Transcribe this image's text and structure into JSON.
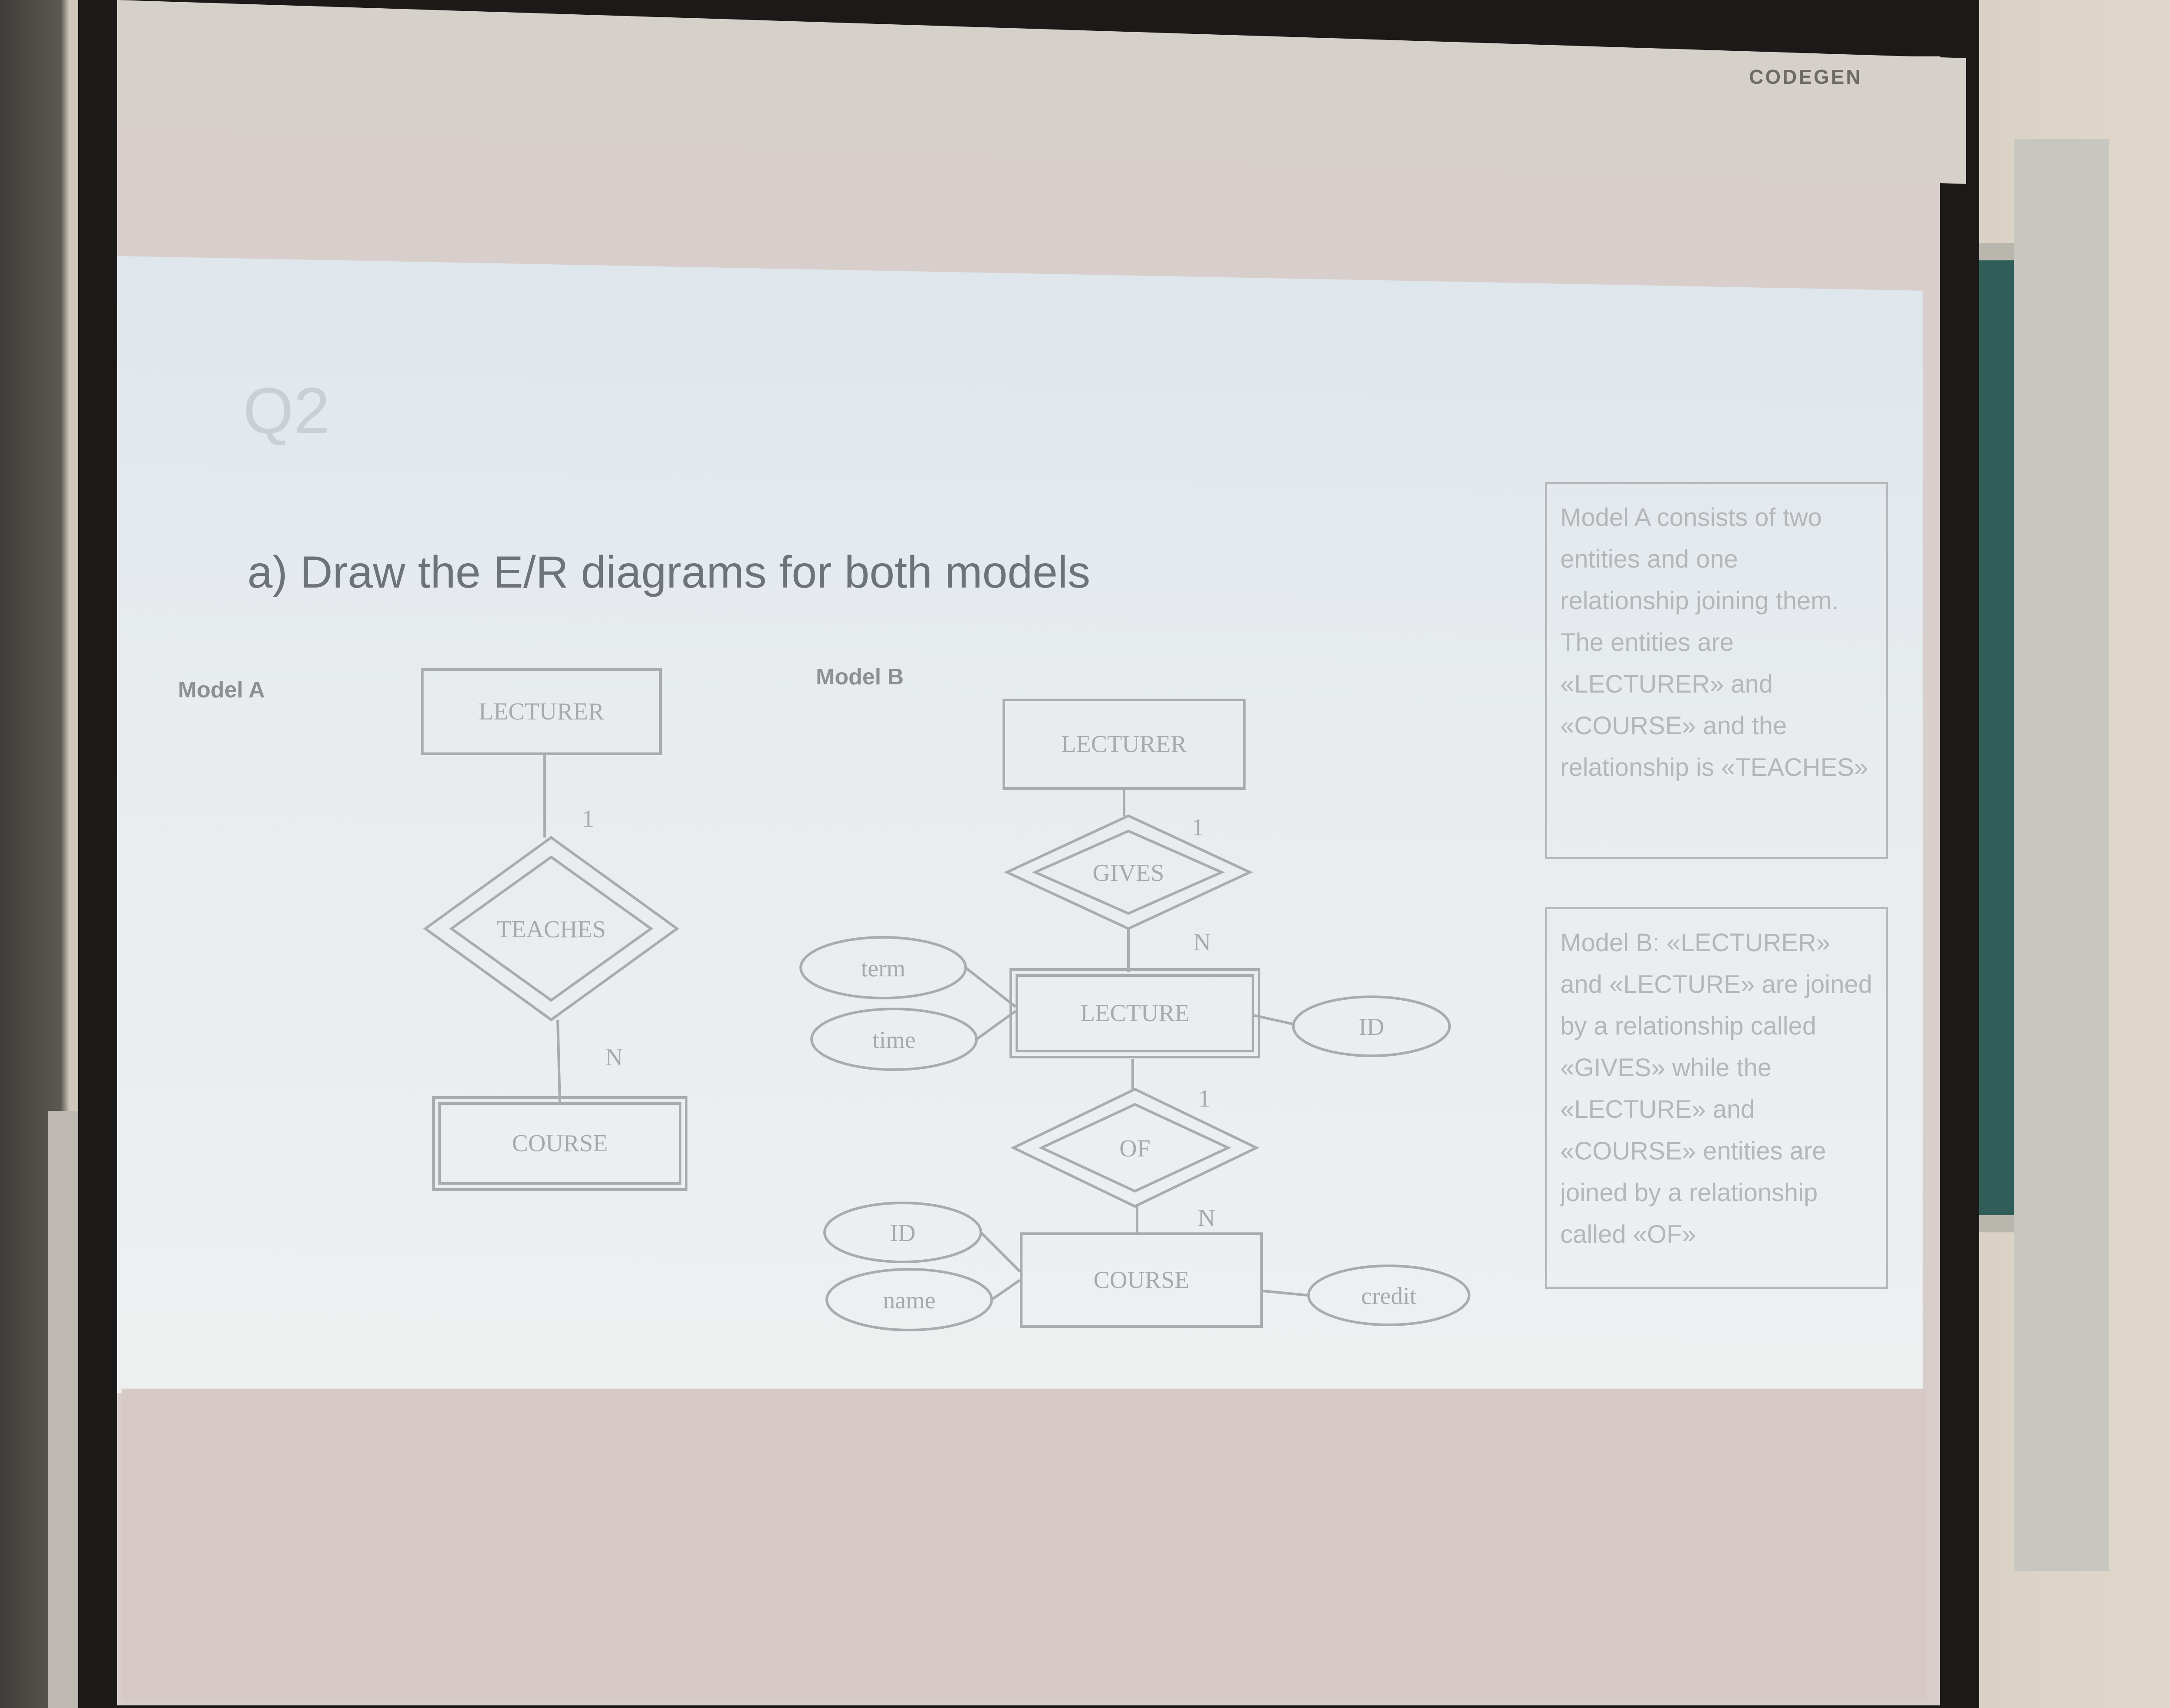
{
  "brand": "CODEGEN",
  "slide": {
    "title": "Q2",
    "instruction": "a) Draw the E/R diagrams for both models",
    "model_a": {
      "label": "Model A",
      "entity_top": "LECTURER",
      "relationship": "TEACHES",
      "entity_bottom": "COURSE",
      "card_top": "1",
      "card_bottom": "N"
    },
    "model_b": {
      "label": "Model B",
      "lecturer": "LECTURER",
      "gives": "GIVES",
      "lecture": "LECTURE",
      "of": "OF",
      "course": "COURSE",
      "attr_term": "term",
      "attr_time": "time",
      "attr_lecture_id": "ID",
      "attr_course_id": "ID",
      "attr_name": "name",
      "attr_credit": "credit",
      "card_1a": "1",
      "card_na": "N",
      "card_1b": "1",
      "card_nb": "N"
    },
    "note_a": "Model A consists of two entities and one relationship joining them. The entities are «LECTURER» and «COURSE» and the relationship is «TEACHES»",
    "note_b": "Model B: «LECTURER» and «LECTURE» are joined by a relationship called «GIVES» while the «LECTURE» and «COURSE» entities are joined by a relationship called «OF»"
  }
}
